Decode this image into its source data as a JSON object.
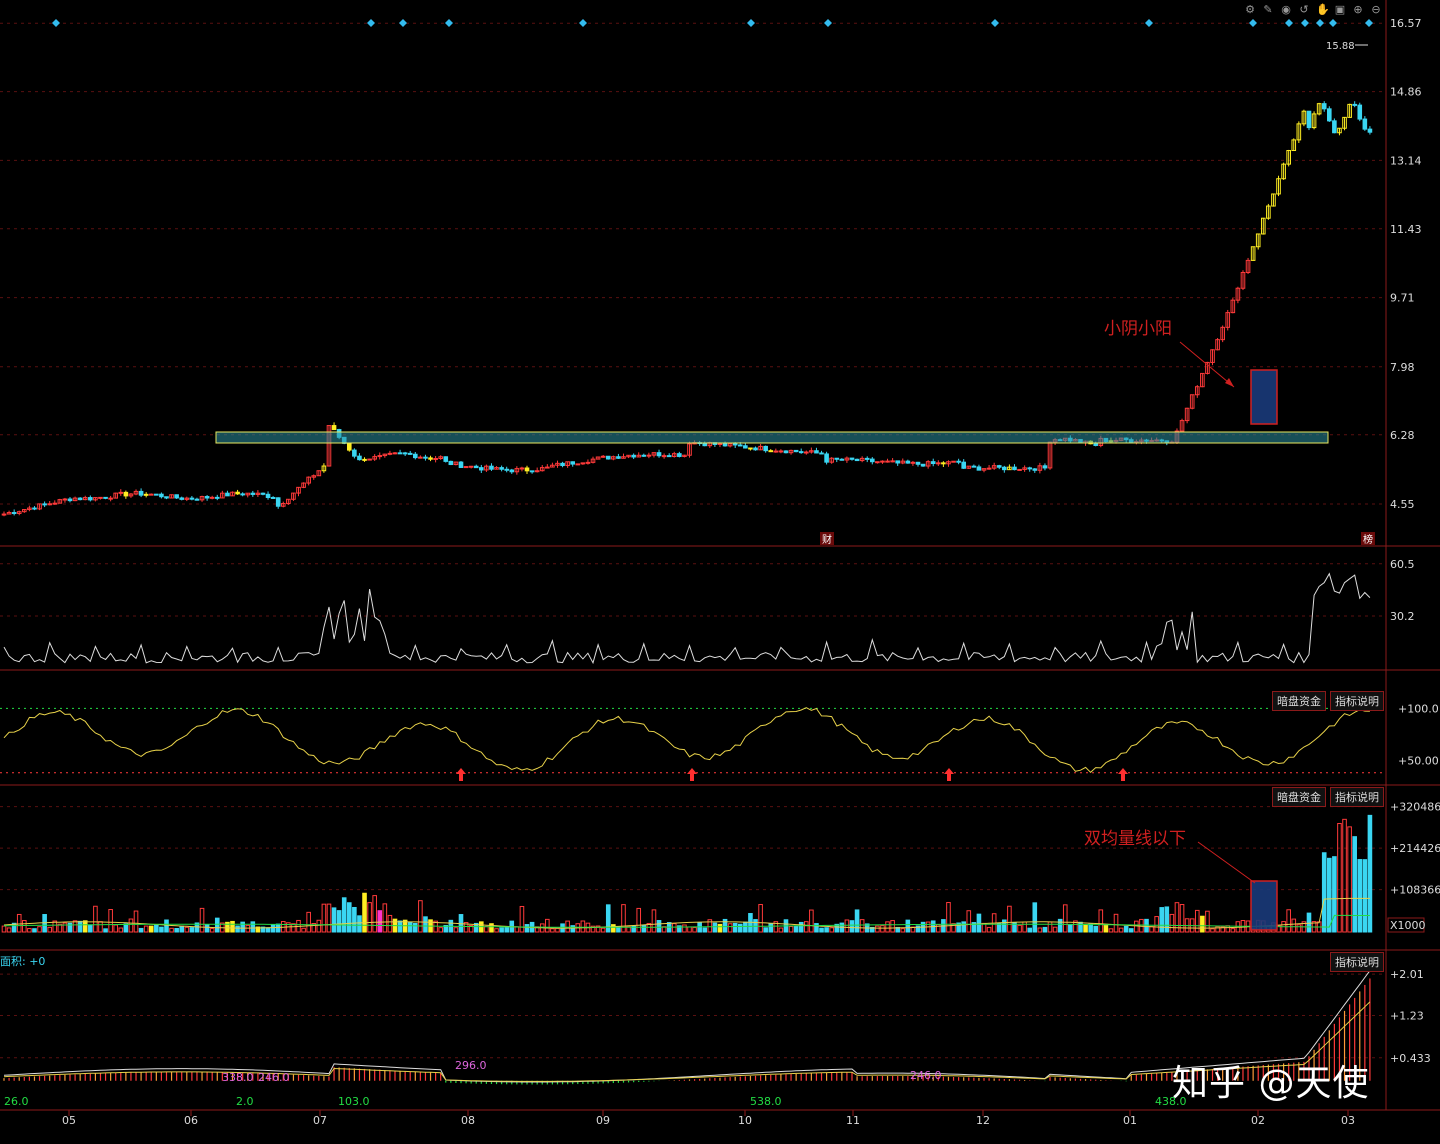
{
  "toolbar": {
    "icons": [
      "settings-icon",
      "pencil-icon",
      "eye-icon",
      "undo-icon",
      "hand-icon",
      "layout-icon",
      "zoom-in-icon",
      "zoom-out-icon"
    ]
  },
  "price_panel": {
    "axis_ticks": [
      "16.57",
      "14.86",
      "13.14",
      "11.43",
      "9.71",
      "7.98",
      "6.28",
      "4.55"
    ],
    "high_marker": "15.88",
    "event_markers": [
      "财",
      "榜"
    ],
    "annotation": "小阴小阳"
  },
  "osc_panel": {
    "axis_ticks": [
      "60.5",
      "30.2"
    ]
  },
  "money_panel": {
    "indicator_button": "暗盘资金",
    "help_button": "指标说明",
    "axis_ticks": [
      "+100.0",
      "+50.00"
    ]
  },
  "volume_panel": {
    "indicator_button": "暗盘资金",
    "help_button": "指标说明",
    "axis_ticks": [
      "+320486",
      "+214426",
      "+108366"
    ],
    "unit": "X1000",
    "annotation": "双均量线以下"
  },
  "area_panel": {
    "label": "面积: +0",
    "help_button": "指标说明",
    "axis_ticks": [
      "+2.01",
      "+1.23",
      "+0.433"
    ],
    "value_labels": [
      "26.0",
      "2.0",
      "103.0",
      "538.0",
      "438.0",
      "338.0",
      "246.0",
      "296.0",
      "246.0"
    ]
  },
  "x_axis": {
    "months": [
      "05",
      "06",
      "07",
      "08",
      "09",
      "10",
      "11",
      "12",
      "01",
      "02",
      "03"
    ]
  },
  "watermark": "知乎 @天使",
  "colors": {
    "up": "#ff3a3a",
    "down": "#3ad6f2",
    "yellow": "#ffee22",
    "magenta": "#ff33cc",
    "frame": "#8b1a1a",
    "grid": "#5a1010",
    "white_line": "#dddddd",
    "gold_line": "#e8d24a",
    "green": "#22dd44"
  },
  "chart_data": [
    {
      "type": "candlestick",
      "title": "",
      "ylim": [
        4.0,
        16.9
      ],
      "ticks": [
        16.57,
        14.86,
        13.14,
        11.43,
        9.71,
        7.98,
        6.28,
        4.55
      ],
      "note": "daily K-line with consolidation band ~5.6-5.9 and breakout to 15.88",
      "annotated_high": 15.88
    },
    {
      "type": "line",
      "title": "",
      "ylim": [
        0,
        65
      ],
      "ticks": [
        60.5,
        30.2
      ]
    },
    {
      "type": "line",
      "title": "",
      "ylim": [
        30,
        110
      ],
      "ticks": [
        100.0,
        50.0
      ]
    },
    {
      "type": "bar",
      "title": "",
      "unit": "X1000",
      "ylim": [
        0,
        340000
      ],
      "ticks": [
        320486,
        214426,
        108366
      ]
    },
    {
      "type": "bar",
      "title": "",
      "ylim": [
        -0.4,
        2.2
      ],
      "ticks": [
        2.01,
        1.23,
        0.433
      ]
    }
  ]
}
